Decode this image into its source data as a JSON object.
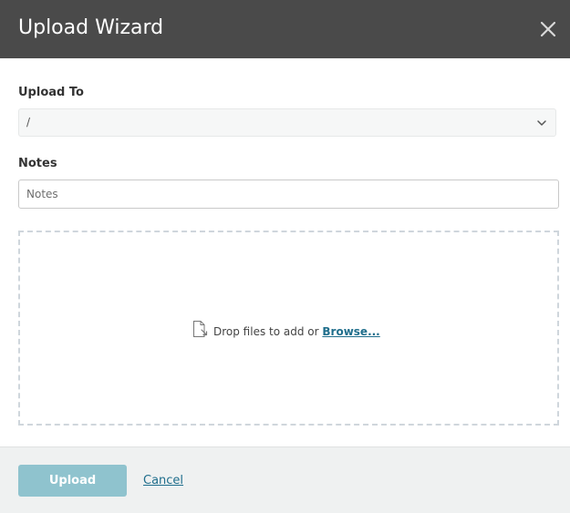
{
  "dialog": {
    "title": "Upload Wizard"
  },
  "upload_to": {
    "label": "Upload To",
    "selected_value": "/"
  },
  "notes": {
    "label": "Notes",
    "placeholder": "Notes",
    "value": ""
  },
  "dropzone": {
    "text": "Drop files to add or ",
    "browse_label": "Browse..."
  },
  "footer": {
    "upload_label": "Upload",
    "cancel_label": "Cancel"
  },
  "icons": {
    "close": "close-icon",
    "chevron": "chevron-down-icon",
    "file": "file-icon"
  },
  "colors": {
    "header_bg": "#4a4a4a",
    "link": "#1f6e8c",
    "upload_button": "#8fc3ce",
    "footer_bg": "#eff1f1"
  }
}
